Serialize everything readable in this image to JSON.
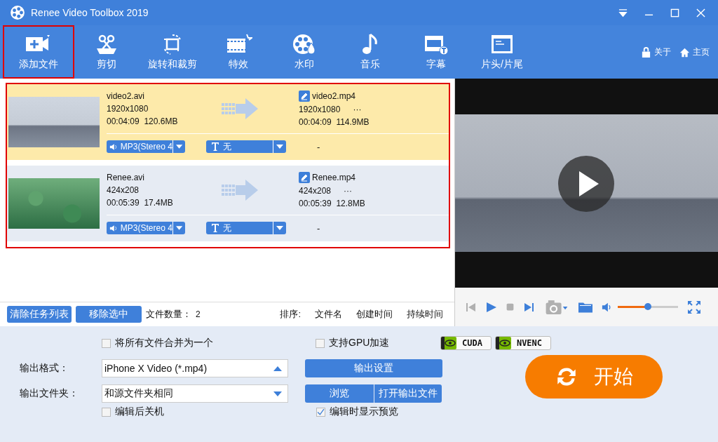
{
  "window": {
    "title": "Renee Video Toolbox 2019"
  },
  "tools": [
    {
      "label": "添加文件",
      "kind": "add",
      "highlighted": true
    },
    {
      "label": "剪切",
      "kind": "cut",
      "highlighted": false
    },
    {
      "label": "旋转和裁剪",
      "kind": "rotate",
      "highlighted": false
    },
    {
      "label": "特效",
      "kind": "effect",
      "highlighted": false
    },
    {
      "label": "水印",
      "kind": "watermark",
      "highlighted": false
    },
    {
      "label": "音乐",
      "kind": "music",
      "highlighted": false
    },
    {
      "label": "字幕",
      "kind": "subtitle",
      "highlighted": false
    },
    {
      "label": "片头/片尾",
      "kind": "intro",
      "highlighted": false
    }
  ],
  "top_links": [
    {
      "label": "关于",
      "kind": "lock"
    },
    {
      "label": "主页",
      "kind": "home"
    }
  ],
  "file_list": {
    "highlighted": true,
    "files": [
      {
        "selected": true,
        "kind": "lake",
        "source": {
          "name": "video2.avi",
          "resolution": "1920x1080",
          "duration": "00:04:09",
          "size": "120.6MB"
        },
        "output": {
          "name": "video2.mp4",
          "resolution": "1920x1080",
          "more": "···",
          "duration": "00:04:09",
          "size": "114.9MB"
        },
        "audio": "MP3(Stereo 4",
        "subtitle": "无",
        "extra": "-"
      },
      {
        "selected": false,
        "kind": "lotus",
        "source": {
          "name": "Renee.avi",
          "resolution": "424x208",
          "duration": "00:05:39",
          "size": "17.4MB"
        },
        "output": {
          "name": "Renee.mp4",
          "resolution": "424x208",
          "more": "···",
          "duration": "00:05:39",
          "size": "12.8MB"
        },
        "audio": "MP3(Stereo 4",
        "subtitle": "无",
        "extra": "-"
      }
    ]
  },
  "list_bar": {
    "buttons": [
      "清除任务列表",
      "移除选中"
    ],
    "count_label": "文件数量：",
    "count": "2",
    "sort_label": "排序: ",
    "sort_options": [
      "文件名",
      "创建时间",
      "持续时间"
    ]
  },
  "player": {
    "volume": {
      "level": 0.5
    }
  },
  "settings": {
    "merge": {
      "label": "将所有文件合并为一个",
      "checked": false
    },
    "gpu": {
      "label": "支持GPU加速",
      "checked": false
    },
    "badges": [
      "CUDA",
      "NVENC"
    ],
    "format": {
      "label": "输出格式：",
      "value": "iPhone X Video (*.mp4)"
    },
    "output_settings": "输出设置",
    "folder": {
      "label": "输出文件夹：",
      "value": "和源文件夹相同"
    },
    "browse": "浏览",
    "open_folder": "打开输出文件",
    "shutdown": {
      "label": "编辑后关机",
      "checked": false
    },
    "preview": {
      "label": "编辑时显示预览",
      "checked": true
    },
    "start": "开始"
  }
}
